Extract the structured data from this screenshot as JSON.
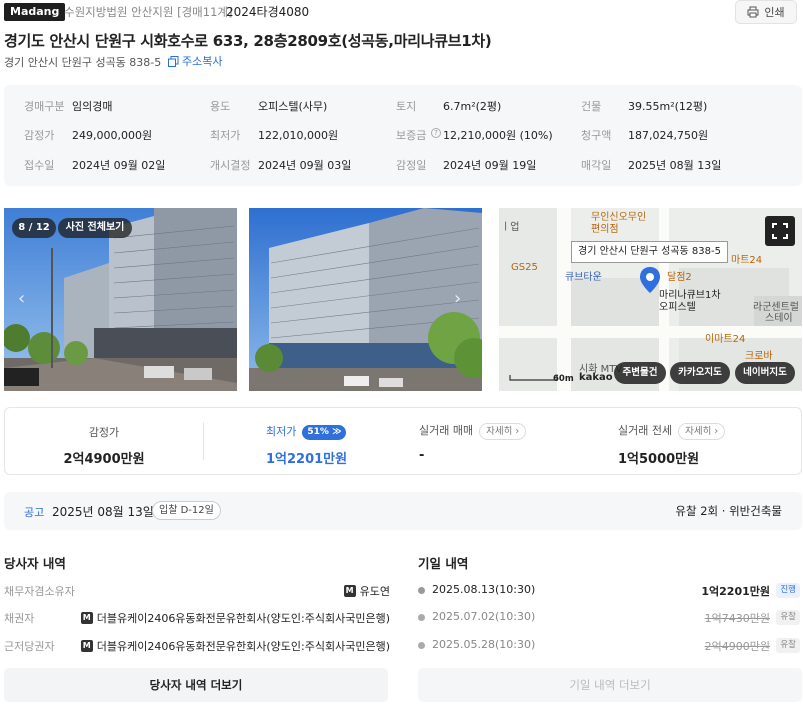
{
  "header": {
    "brand": "Madang",
    "court": "수원지방법원 안산지원 [경매11계]",
    "case_number": "2024타경4080",
    "print_label": "인쇄"
  },
  "title": "경기도 안산시 단원구 시화호수로 633, 28층2809호(성곡동,마리나큐브1차)",
  "lot_address": "경기 안산시 단원구 성곡동 838-5",
  "copy_label": "주소복사",
  "info": {
    "auction_type": {
      "label": "경매구분",
      "value": "임의경매"
    },
    "usage": {
      "label": "용도",
      "value": "오피스텔(사무)"
    },
    "land": {
      "label": "토지",
      "value": "6.7m²(2평)"
    },
    "building": {
      "label": "건물",
      "value": "39.55m²(12평)"
    },
    "appraisal": {
      "label": "감정가",
      "value": "249,000,000원"
    },
    "minimum": {
      "label": "최저가",
      "value": "122,010,000원"
    },
    "deposit": {
      "label": "보증금",
      "value": "12,210,000원 (10%)"
    },
    "claim": {
      "label": "청구액",
      "value": "187,024,750원"
    },
    "received": {
      "label": "접수일",
      "value": "2024년 09월 02일"
    },
    "start_decision": {
      "label": "개시결정",
      "value": "2024년 09월 03일"
    },
    "appraisal_date": {
      "label": "감정일",
      "value": "2024년 09월 19일"
    },
    "sale_date": {
      "label": "매각일",
      "value": "2025년 08월 13일"
    }
  },
  "gallery": {
    "counter": "8 / 12",
    "view_all": "사진 전체보기"
  },
  "map": {
    "pin_label": "경기 안산시 단원구 성곡동 838-5",
    "building_label": "마리나큐브1차\n오피스텔",
    "place_labels": [
      "무인신오무인",
      "편의점",
      "GS25",
      "큐브타운",
      "달점2",
      "마트24",
      "라군센트럴",
      "스테이",
      "이마트24",
      "크로바",
      "시화 MTV"
    ],
    "scale_label": "60m",
    "logo": "kakao",
    "buttons": [
      "주변물건",
      "카카오지도",
      "네이버지도"
    ]
  },
  "prices": {
    "appraisal": {
      "label": "감정가",
      "value": "2억4900만원"
    },
    "minimum": {
      "label": "최저가",
      "value": "1억2201만원",
      "pct": "51%"
    },
    "trade_sale": {
      "label": "실거래 매매",
      "value": "-",
      "detail": "자세히"
    },
    "trade_jeonse": {
      "label": "실거래 전세",
      "value": "1억5000만원",
      "detail": "자세히"
    }
  },
  "notice": {
    "label": "공고",
    "date": "2025년 08월 13일",
    "dday": "입찰 D-12일",
    "right": "유찰 2회 · 위반건축물"
  },
  "parties": {
    "title": "당사자 내역",
    "rows": [
      {
        "label": "채무자겸소유자",
        "value": "유도연"
      },
      {
        "label": "채권자",
        "value": "더블유케이2406유동화전문유한회사(양도인:주식회사국민은행)"
      },
      {
        "label": "근저당권자",
        "value": "더블유케이2406유동화전문유한회사(양도인:주식회사국민은행)"
      }
    ],
    "more": "당사자 내역 더보기"
  },
  "schedule": {
    "title": "기일 내역",
    "rows": [
      {
        "date": "2025.08.13(10:30)",
        "price": "1억2201만원",
        "status": "진행"
      },
      {
        "date": "2025.07.02(10:30)",
        "price": "1억7430만원",
        "status": "유찰"
      },
      {
        "date": "2025.05.28(10:30)",
        "price": "2억4900만원",
        "status": "유찰"
      }
    ],
    "more": "기일 내역 더보기"
  },
  "colors": {
    "accent": "#2f6fde",
    "dark": "#1f1f1f",
    "panel": "#f6f7f8"
  }
}
